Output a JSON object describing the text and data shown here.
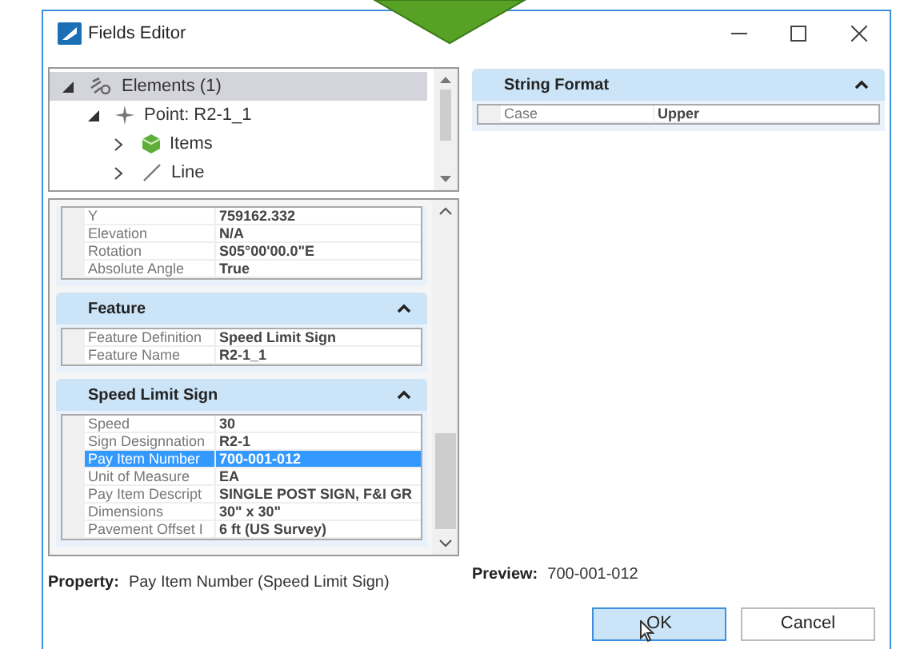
{
  "window": {
    "title": "Fields Editor"
  },
  "tree": [
    {
      "label": "Elements (1)",
      "kind": "elements",
      "expanded": true,
      "selected": true,
      "children": [
        {
          "label": "Point: R2-1_1",
          "kind": "point",
          "expanded": true,
          "selected": false,
          "children": [
            {
              "label": "Items",
              "kind": "items",
              "expanded": false,
              "selected": false
            },
            {
              "label": "Line",
              "kind": "line",
              "expanded": false,
              "selected": false
            }
          ]
        }
      ]
    }
  ],
  "property_groups": [
    {
      "rows": [
        {
          "label": "Y",
          "value": "759162.332",
          "selected": false
        },
        {
          "label": "Elevation",
          "value": "N/A",
          "selected": false
        },
        {
          "label": "Rotation",
          "value": "S05°00'00.0\"E",
          "selected": false
        },
        {
          "label": "Absolute Angle",
          "value": "True",
          "selected": false
        }
      ]
    },
    {
      "title": "Feature",
      "expanded": true,
      "rows": [
        {
          "label": "Feature Definition",
          "value": "Speed Limit Sign",
          "selected": false
        },
        {
          "label": "Feature Name",
          "value": "R2-1_1",
          "selected": false
        }
      ]
    },
    {
      "title": "Speed Limit Sign",
      "expanded": true,
      "rows": [
        {
          "label": "Speed",
          "value": "30",
          "selected": false
        },
        {
          "label": "Sign Designnation",
          "value": "R2-1",
          "selected": false
        },
        {
          "label": "Pay Item Number",
          "value": "700-001-012",
          "selected": true
        },
        {
          "label": "Unit of Measure",
          "value": "EA",
          "selected": false
        },
        {
          "label": "Pay Item Descript",
          "value": "SINGLE POST SIGN, F&I GR",
          "selected": false
        },
        {
          "label": "Dimensions",
          "value": "30\" x 30\"",
          "selected": false
        },
        {
          "label": "Pavement Offset I",
          "value": "6 ft (US Survey)",
          "selected": false
        }
      ]
    }
  ],
  "right_groups": [
    {
      "title": "String Format",
      "expanded": true,
      "rows": [
        {
          "label": "Case",
          "value": "Upper",
          "selected": false
        }
      ]
    }
  ],
  "property": {
    "label": "Property:",
    "value": "Pay Item Number (Speed Limit Sign)"
  },
  "preview": {
    "label": "Preview:",
    "value": "700-001-012"
  },
  "buttons": [
    {
      "label": "OK",
      "default": true
    },
    {
      "label": "Cancel",
      "default": false
    }
  ]
}
